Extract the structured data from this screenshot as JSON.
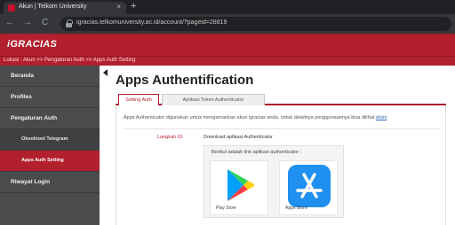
{
  "browser": {
    "tab_title": "Akun | Telkom University",
    "tab_close": "×",
    "new_tab": "+",
    "nav_back": "←",
    "nav_forward": "→",
    "nav_reload": "C",
    "url": "igracias.telkomuniversity.ac.id/account/?pageid=28819"
  },
  "site": {
    "logo": "iGRACIAS",
    "breadcrumb": "Lokasi : Akun >> Pengaturan Auth >> Apps Auth Setting"
  },
  "sidebar": {
    "items": [
      {
        "label": "Beranda"
      },
      {
        "label": "Profiles"
      },
      {
        "label": "Pengaturan Auth"
      },
      {
        "label": "Obsektool Telegram"
      },
      {
        "label": "Apps Auth Setting"
      },
      {
        "label": "Riwayat Login"
      }
    ]
  },
  "main": {
    "title": "Apps Authentification",
    "tabs": [
      {
        "label": "Setting Auth"
      },
      {
        "label": "Aplikasi Token Authenticator"
      }
    ],
    "description": "Apps Authenticator digunakan untuk  mengamankan akun igracias anda, untuk detailnya penggunaannya bisa dilihat",
    "description_link": "disini",
    "step_label": "Langkah 01",
    "step_title": "Download aplikasi Authenticator",
    "apps_caption": "Berikut adalah link aplikasi authenticator :",
    "apps": [
      {
        "name": "Play Store",
        "icon": "google-play-icon"
      },
      {
        "name": "Apps Store",
        "icon": "app-store-icon"
      }
    ]
  },
  "colors": {
    "brand": "#b21f2d",
    "sidebar": "#4a4b4d",
    "link": "#2f6fb5"
  }
}
